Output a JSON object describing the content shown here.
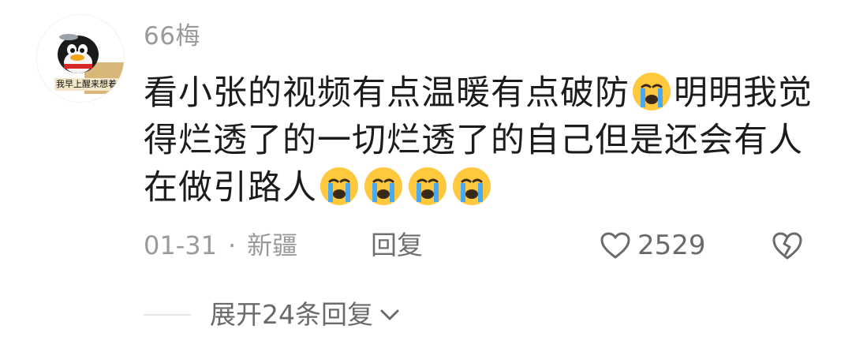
{
  "comment": {
    "username": "66梅",
    "avatar_caption": "我早上醒来想着",
    "text_lines": [
      [
        "看小张的视频有点温暖有点破防",
        "emoji:cry",
        "明明我觉"
      ],
      [
        "得烂透了的一切烂透了的自己但是还会有人"
      ],
      [
        "在做引路人",
        "emoji:cry",
        "emoji:cry",
        "emoji:cry",
        "emoji:cry"
      ]
    ],
    "line_1_part_1": "看小张的视频有点温暖有点破防",
    "line_1_part_2": "明明我觉",
    "line_2": "得烂透了的一切烂透了的自己但是还会有人",
    "line_3": "在做引路人",
    "date": "01-31",
    "separator": "·",
    "location": "新疆",
    "reply_label": "回复",
    "like_count": "2529",
    "emoji_name": "crying-face-emoji"
  },
  "replies": {
    "expand_label": "展开24条回复"
  },
  "colors": {
    "text_primary": "#1c1c1c",
    "text_secondary": "#9a9a9a",
    "emoji_face": "#ffc83d",
    "emoji_tears": "#4aa8f0"
  }
}
